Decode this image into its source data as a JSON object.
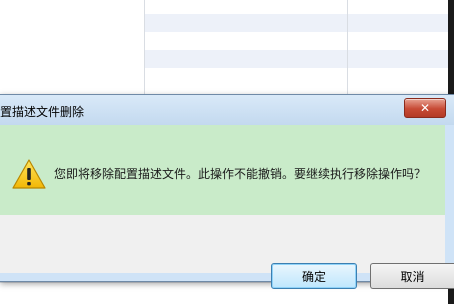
{
  "dialog": {
    "title": "置描述文件删除",
    "close_symbol": "✕",
    "message": "您即将移除配置描述文件。此操作不能撤销。要继续执行移除操作吗？",
    "ok_label": "确定",
    "cancel_label": "取消",
    "icon": "warning-icon"
  },
  "colors": {
    "message_background": "#c9ebc9",
    "titlebar": "#c3d9ef",
    "close_button": "#c74a35",
    "default_button_border": "#3c7fb1"
  }
}
